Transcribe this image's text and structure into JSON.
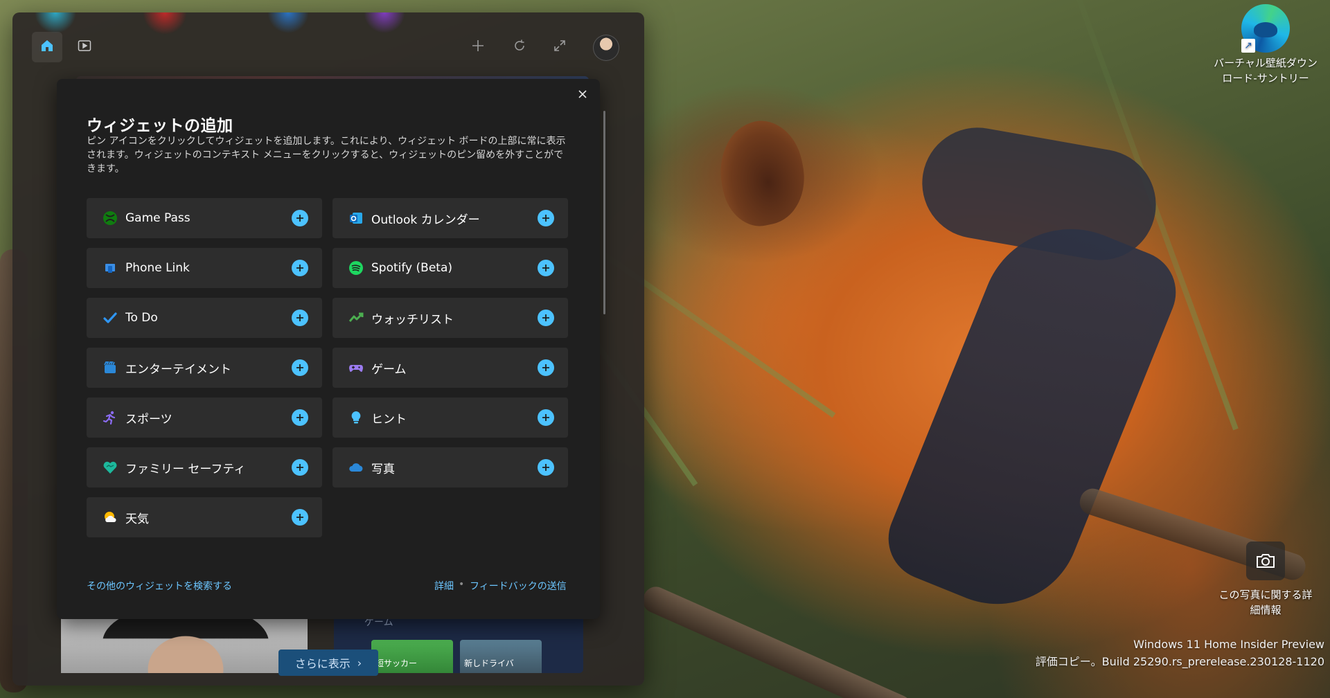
{
  "desktop": {
    "icons": [
      {
        "label_line1": "バーチャル壁紙ダウン",
        "label_line2": "ロード-サントリー",
        "icon": "edge-icon"
      },
      {
        "label_line1": "この写真に関する詳",
        "label_line2": "細情報",
        "icon": "camera-icon"
      }
    ],
    "watermark": {
      "line1": "Windows 11 Home Insider Preview",
      "line2": "評価コピー。Build 25290.rs_prerelease.230128-1120"
    }
  },
  "board": {
    "header_icons": [
      "home-icon",
      "video-icon",
      "add-icon",
      "refresh-icon",
      "expand-icon",
      "profile-avatar"
    ],
    "more_button": "さらに表示",
    "games_card_label": "ゲーム",
    "games_card_menu": "···",
    "games": [
      {
        "title": "短サッカー"
      },
      {
        "title": "新しドライバ"
      }
    ]
  },
  "dialog": {
    "title": "ウィジェットの追加",
    "description": "ピン アイコンをクリックしてウィジェットを追加します。これにより、ウィジェット ボードの上部に常に表示されます。ウィジェットのコンテキスト メニューをクリックすると、ウィジェットのピン留めを外すことができます。",
    "widgets": [
      {
        "name": "Game Pass",
        "icon": "xbox-icon"
      },
      {
        "name": "Outlook カレンダー",
        "icon": "outlook-icon"
      },
      {
        "name": "Phone Link",
        "icon": "phone-link-icon"
      },
      {
        "name": "Spotify (Beta)",
        "icon": "spotify-icon"
      },
      {
        "name": "To Do",
        "icon": "todo-icon"
      },
      {
        "name": "ウォッチリスト",
        "icon": "watchlist-icon"
      },
      {
        "name": "エンターテイメント",
        "icon": "entertainment-icon"
      },
      {
        "name": "ゲーム",
        "icon": "gamepad-icon"
      },
      {
        "name": "スポーツ",
        "icon": "sports-icon"
      },
      {
        "name": "ヒント",
        "icon": "tips-icon"
      },
      {
        "name": "ファミリー セーフティ",
        "icon": "family-safety-icon"
      },
      {
        "name": "写真",
        "icon": "photos-icon"
      },
      {
        "name": "天気",
        "icon": "weather-icon"
      }
    ],
    "footer": {
      "find_more": "その他のウィジェットを検索する",
      "details": "詳細",
      "separator": "•",
      "feedback": "フィードバックの送信"
    }
  },
  "colors": {
    "accent": "#4cc2ff",
    "link": "#6cc6ff",
    "dialog_bg": "#1f1f1f",
    "tile_bg": "#2d2d2d"
  }
}
